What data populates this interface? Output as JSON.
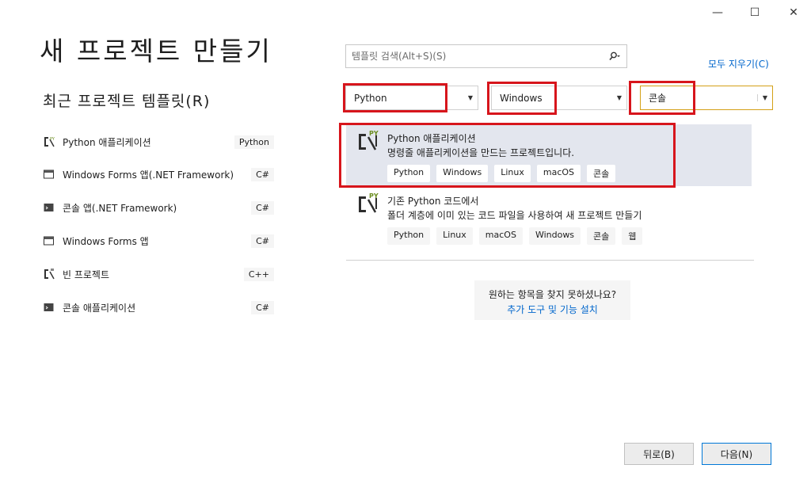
{
  "window_controls": {
    "minimize": "—",
    "maximize": "☐",
    "close": "✕"
  },
  "title": "새 프로젝트 만들기",
  "recent": {
    "title": "최근 프로젝트 템플릿(R)",
    "items": [
      {
        "label": "Python 애플리케이션",
        "tag": "Python",
        "icon": "python-project-icon"
      },
      {
        "label": "Windows Forms 앱(.NET Framework)",
        "tag": "C#",
        "icon": "windows-form-icon"
      },
      {
        "label": "콘솔 앱(.NET Framework)",
        "tag": "C#",
        "icon": "console-icon"
      },
      {
        "label": "Windows Forms 앱",
        "tag": "C#",
        "icon": "windows-form-icon"
      },
      {
        "label": "빈 프로젝트",
        "tag": "C++",
        "icon": "blank-project-icon"
      },
      {
        "label": "콘솔 애플리케이션",
        "tag": "C#",
        "icon": "console-icon"
      }
    ]
  },
  "search": {
    "placeholder": "템플릿 검색(Alt+S)(S)",
    "icon": "search-icon"
  },
  "clear_all": "모두 지우기(C)",
  "filters": {
    "language": "Python",
    "platform": "Windows",
    "project_type": "콘솔"
  },
  "templates": [
    {
      "name": "Python 애플리케이션",
      "description": "명령줄 애플리케이션을 만드는 프로젝트입니다.",
      "tags": [
        "Python",
        "Windows",
        "Linux",
        "macOS",
        "콘솔"
      ],
      "selected": true
    },
    {
      "name": "기존 Python 코드에서",
      "description": "폴더 계층에 이미 있는 코드 파일을 사용하여 새 프로젝트 만들기",
      "tags": [
        "Python",
        "Linux",
        "macOS",
        "Windows",
        "콘솔",
        "웹"
      ],
      "selected": false
    }
  ],
  "not_found": {
    "question": "원하는 항목을 찾지 못하셨나요?",
    "link": "추가 도구 및 기능 설치"
  },
  "buttons": {
    "back": "뒤로(B)",
    "next": "다음(N)"
  },
  "colors": {
    "highlight": "#d7151c",
    "link": "#0066cc",
    "selected_bg": "#e3e6ee"
  }
}
